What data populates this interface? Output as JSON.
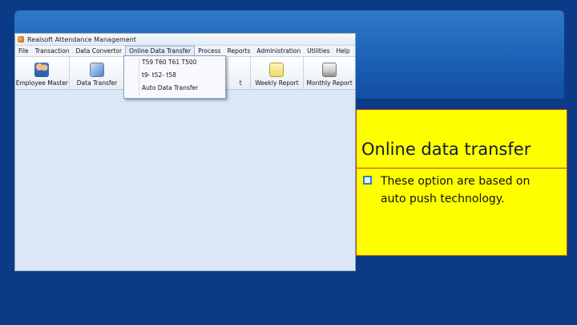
{
  "window": {
    "title": "Realsoft Attendance Management"
  },
  "menubar": {
    "items": [
      "File",
      "Transaction",
      "Data Convertor",
      "Online Data Transfer",
      "Process",
      "Reports",
      "Administration",
      "Utilities",
      "Help"
    ]
  },
  "toolbar": {
    "items": [
      {
        "label": "Employee Master",
        "icon": "employees-icon"
      },
      {
        "label": "Data Transfer",
        "icon": "data-transfer-icon"
      },
      {
        "label": "t",
        "icon": ""
      },
      {
        "label": "Weekly Report",
        "icon": "weekly-report-icon"
      },
      {
        "label": "Monthly Report",
        "icon": "monthly-report-icon"
      }
    ]
  },
  "dropdown": {
    "items": [
      "T59 T60 T61 T500",
      "t9- t52- t58",
      "Auto Data Transfer"
    ]
  },
  "callout": {
    "title": "Online data transfer",
    "bullet": "These option are based on auto push technology."
  },
  "colors": {
    "slide_background": "#0b3a86",
    "callout_background": "#ffff00",
    "callout_border": "#c0392b",
    "bullet": "#2d7fd6"
  }
}
